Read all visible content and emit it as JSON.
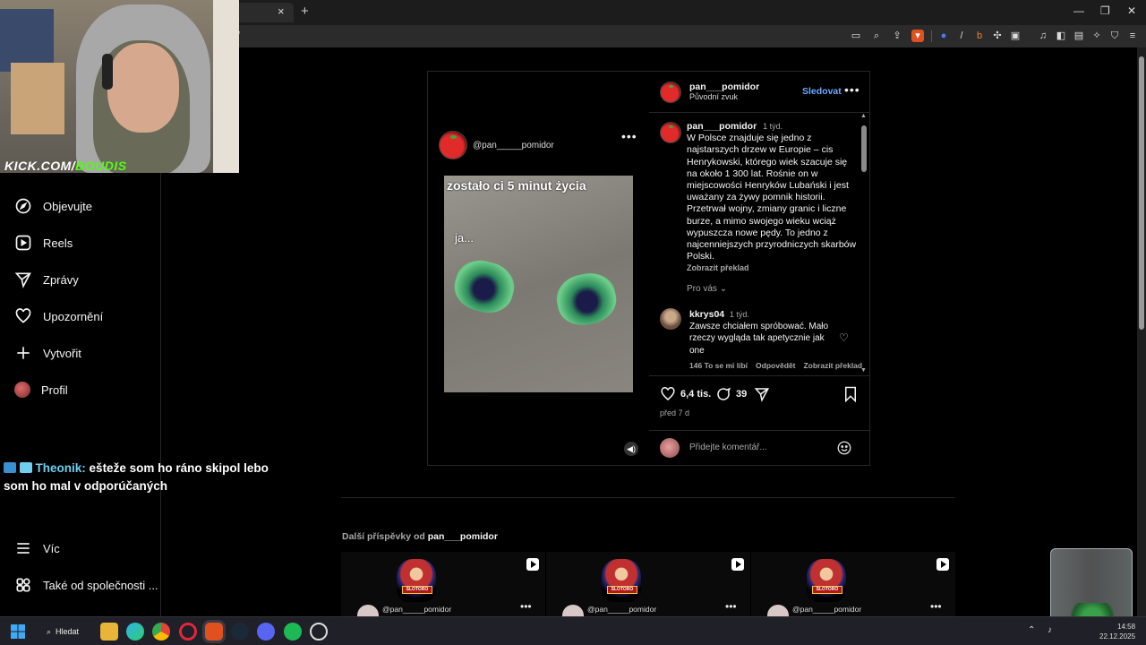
{
  "browser": {
    "tab_close": "×",
    "new_tab": "+",
    "window_controls": [
      "—",
      "❐",
      "✕"
    ],
    "address_fragment": "/"
  },
  "sidebar": {
    "items": [
      {
        "label": "Objevujte",
        "icon": "compass-icon"
      },
      {
        "label": "Reels",
        "icon": "reels-icon"
      },
      {
        "label": "Zprávy",
        "icon": "send-icon"
      },
      {
        "label": "Upozornění",
        "icon": "heart-icon"
      },
      {
        "label": "Vytvořit",
        "icon": "plus-icon"
      },
      {
        "label": "Profil",
        "icon": "avatar"
      }
    ],
    "bottom_items": [
      {
        "label": "Víc",
        "icon": "menu-icon"
      },
      {
        "label": "Také od společnosti ...",
        "icon": "apps-icon"
      }
    ]
  },
  "post": {
    "media": {
      "username": "@pan_____pomidor",
      "caption_top": "zostało ci 5 minut życia",
      "caption_mid": "ja..."
    },
    "author": "pan___pomidor",
    "audio": "Původní zvuk",
    "follow_label": "Sledovat",
    "caption": {
      "username": "pan___pomidor",
      "time": "1 týd.",
      "text": "W Polsce znajduje się jedno z najstarszych drzew w Europie – cis Henrykowski, którego wiek szacuje się na około 1 300 lat. Rośnie on w miejscowości Henryków Lubański i jest uważany za żywy pomnik historii. Przetrwał wojny, zmiany granic i liczne burze, a mimo swojego wieku wciąż wypuszcza nowe pędy. To jedno z najcenniejszych przyrodniczych skarbów Polski.",
      "translate": "Zobrazit překlad"
    },
    "for_you": "Pro vás",
    "comment": {
      "username": "kkrys04",
      "time": "1 týd.",
      "text": "Zawsze chciałem spróbować. Mało rzeczy wygląda tak apetycznie jak one",
      "likes": "146 To se mi líbí",
      "reply": "Odpovědět",
      "translate": "Zobrazit překlad"
    },
    "likes": "6,4 tis.",
    "comments_count": "39",
    "posted": "před 7 d",
    "add_comment_placeholder": "Přidejte komentář..."
  },
  "more_posts": {
    "title_prefix": "Další příspěvky od",
    "author": "pan___pomidor",
    "thumbs": [
      {
        "username": "@pan_____pomidor",
        "badge": "SLOTORO"
      },
      {
        "username": "@pan_____pomidor",
        "badge": "SLOTORO"
      },
      {
        "username": "@pan_____pomidor",
        "badge": "SLOTORO"
      }
    ]
  },
  "overlay": {
    "stream_brand": "KICK.COM/",
    "stream_name": "BOUDIS",
    "chat_user": "Theonik:",
    "chat_text": "ešteže som ho ráno skipol lebo som ho mal v odporúčaných"
  },
  "taskbar": {
    "search_label": "Hledat",
    "time": "14:58",
    "date": "22.12.2025"
  },
  "colors": {
    "accent_link": "#6fa8ff",
    "kick_green": "#53fc18"
  }
}
